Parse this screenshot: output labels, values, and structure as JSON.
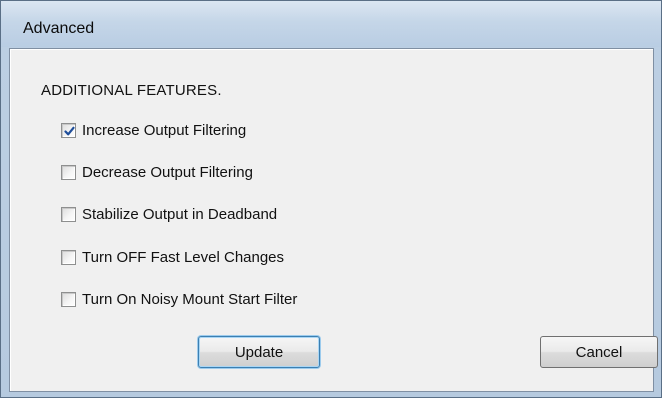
{
  "window": {
    "title": "Advanced"
  },
  "dialog": {
    "heading": "ADDITIONAL FEATURES.",
    "options": [
      {
        "label": "Increase Output Filtering",
        "checked": true
      },
      {
        "label": "Decrease Output Filtering",
        "checked": false
      },
      {
        "label": "Stabilize Output in Deadband",
        "checked": false
      },
      {
        "label": "Turn OFF Fast Level Changes",
        "checked": false
      },
      {
        "label": "Turn On Noisy Mount Start Filter",
        "checked": false
      }
    ],
    "update_label": "Update",
    "cancel_label": "Cancel"
  },
  "colors": {
    "check_mark": "#1f4e9a",
    "default_button_border": "#3c7fb1"
  }
}
